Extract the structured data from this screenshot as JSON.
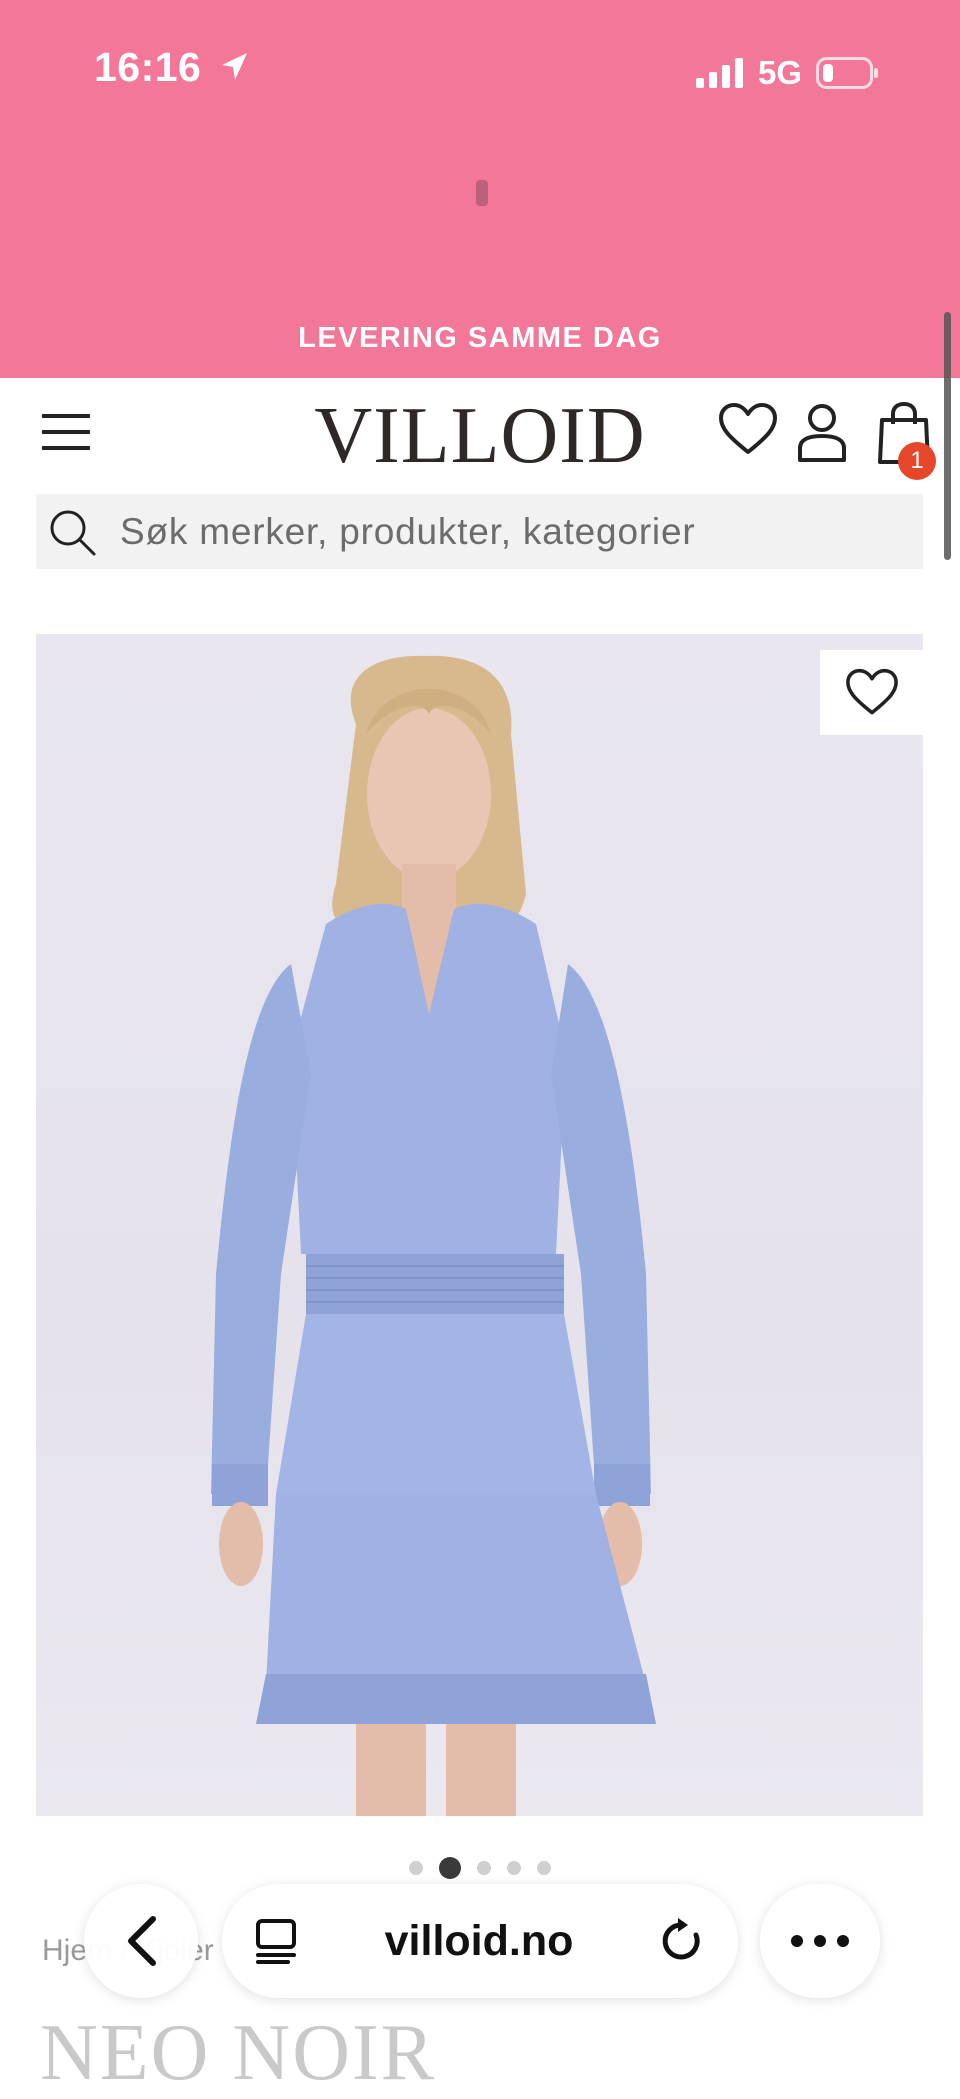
{
  "status_bar": {
    "time": "16:16",
    "network": "5G"
  },
  "promo": {
    "text": "LEVERING SAMME DAG"
  },
  "header": {
    "logo": "VILLOID",
    "cart_count": "1"
  },
  "search": {
    "placeholder": "Søk merker, produkter, kategorier",
    "value": ""
  },
  "product": {
    "image_alt": "Blonde model wearing a light blue long-sleeve mini dress with ruffled tiers",
    "carousel": {
      "total": 5,
      "active_index": 2
    },
    "breadcrumb": "Hjem / Kjoler",
    "brand": "NEO NOIR"
  },
  "browser": {
    "url": "villoid.no"
  },
  "colors": {
    "brand_pink": "#f37798",
    "badge_red": "#e6462a",
    "dress_blue": "#9fb2e3"
  }
}
